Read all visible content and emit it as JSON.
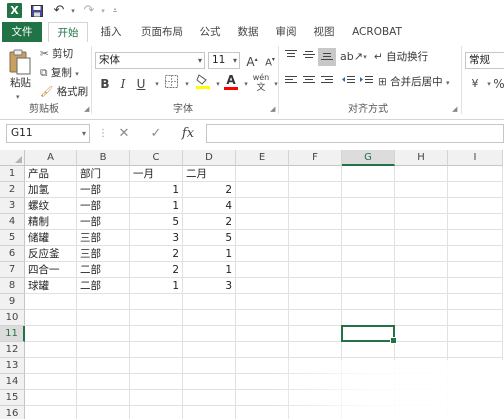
{
  "app": {
    "logo": "X"
  },
  "quick_access": {
    "undo_symbol": "↶",
    "redo_symbol": "↷"
  },
  "tabs": [
    {
      "label": "文件"
    },
    {
      "label": "开始"
    },
    {
      "label": "插入"
    },
    {
      "label": "页面布局"
    },
    {
      "label": "公式"
    },
    {
      "label": "数据"
    },
    {
      "label": "审阅"
    },
    {
      "label": "视图"
    },
    {
      "label": "ACROBAT"
    }
  ],
  "ribbon": {
    "clipboard": {
      "paste": "粘贴",
      "cut": "剪切",
      "copy": "复制",
      "format_painter": "格式刷",
      "group_label": "剪贴板"
    },
    "font": {
      "font_name": "宋体",
      "font_size": "11",
      "grow": "A",
      "shrink": "A",
      "bold": "B",
      "italic": "I",
      "underline": "U",
      "font_color": "A",
      "phonetic": "wén",
      "group_label": "字体"
    },
    "alignment": {
      "wrap_text": "自动换行",
      "merge_center": "合并后居中",
      "group_label": "对齐方式"
    },
    "number": {
      "format": "常规",
      "percent": "%"
    }
  },
  "formula_bar": {
    "name_box": "G11",
    "cancel": "✕",
    "enter": "✓",
    "fx": "fx",
    "value": ""
  },
  "columns": [
    "A",
    "B",
    "C",
    "D",
    "E",
    "F",
    "G",
    "H",
    "I"
  ],
  "selected_column": "G",
  "selected_row": 11,
  "rows": [
    "1",
    "2",
    "3",
    "4",
    "5",
    "6",
    "7",
    "8",
    "9",
    "10",
    "11",
    "12",
    "13",
    "14",
    "15",
    "16"
  ],
  "sheet": {
    "header": [
      "产品",
      "部门",
      "一月",
      "二月"
    ],
    "records": [
      [
        "加氢",
        "一部",
        "1",
        "2"
      ],
      [
        "螺纹",
        "一部",
        "1",
        "4"
      ],
      [
        "精制",
        "一部",
        "5",
        "2"
      ],
      [
        "储罐",
        "三部",
        "3",
        "5"
      ],
      [
        "反应釜",
        "三部",
        "2",
        "1"
      ],
      [
        "四合一",
        "二部",
        "2",
        "1"
      ],
      [
        "球罐",
        "二部",
        "1",
        "3"
      ]
    ]
  }
}
